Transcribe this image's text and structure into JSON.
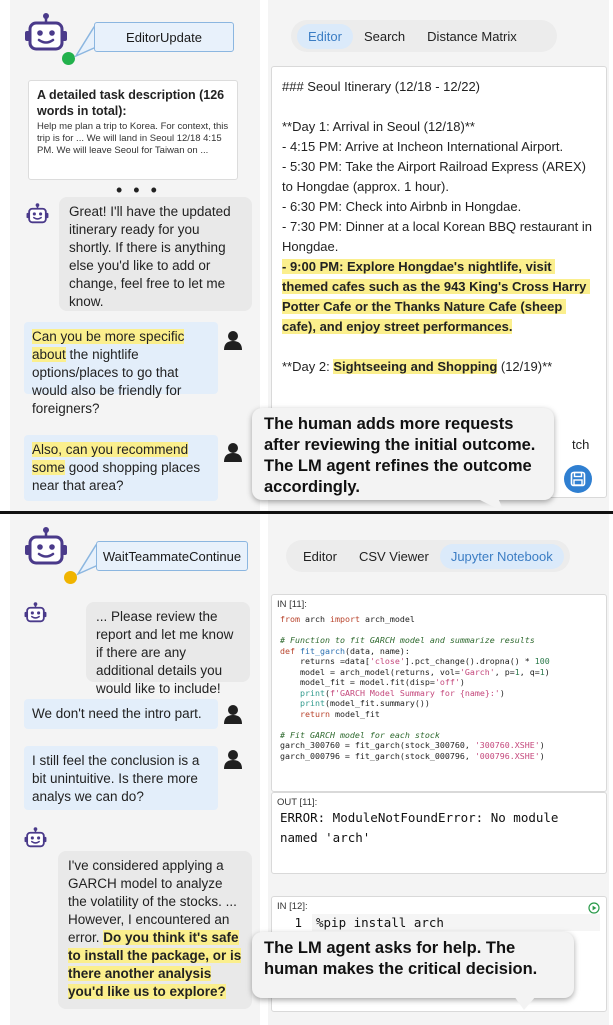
{
  "top": {
    "agent_state": "EditorUpdate",
    "status_color": "#22b14c",
    "task_card": {
      "title": "A detailed task description (126 words in total):",
      "body": "Help me plan a trip to Korea. For context, this trip is for ... We will land in Seoul 12/18 4:15 PM. We will leave Seoul for Taiwan on ..."
    },
    "ellipsis": "• • •",
    "agent_message": "Great! I'll have the updated itinerary ready for you shortly. If there is anything else you'd like to add or change, feel free to let me know.",
    "user_message_1": {
      "highlight": "Can you be more specific about",
      "rest": " the nightlife options/places to go that would also be friendly for foreigners?"
    },
    "user_message_2": {
      "highlight": "Also, can you recommend some",
      "rest": " good shopping places near that area?"
    },
    "tabs": [
      "Editor",
      "Search",
      "Distance Matrix"
    ],
    "active_tab": "Editor",
    "editor": {
      "heading": "### Seoul Itinerary (12/18 - 12/22)",
      "day1": "**Day 1: Arrival in Seoul (12/18)**",
      "lines": [
        "- 4:15 PM: Arrive at Incheon International Airport.",
        "- 5:30 PM: Take the Airport Railroad Express (AREX) to Hongdae (approx. 1 hour).",
        "- 6:30 PM: Check into Airbnb in Hongdae.",
        "- 7:30 PM: Dinner at a local Korean BBQ restaurant in Hongdae."
      ],
      "highlight_line": "- 9:00 PM: Explore Hongdae's nightlife, visit themed cafes such as the 943 King's Cross Harry Potter Cafe or the Thanks Nature Cafe (sheep cafe), and enjoy street performances.",
      "day2_prefix": "**Day 2: ",
      "day2_highlight": "Sightseeing and Shopping",
      "day2_suffix": " (12/19)**",
      "partial_text": "tch"
    },
    "callout": "The human adds more requests after reviewing the initial outcome. The LM agent refines the outcome accordingly."
  },
  "bottom": {
    "agent_state": "WaitTeammateContinue",
    "status_color": "#f0b400",
    "agent_message_1": "... Please review the report and let me know if there are any additional details you would like to include!",
    "user_message_1": "We don't need the intro part.",
    "user_message_2": "I still feel the conclusion is a bit unintuitive. Is there more analys we can do?",
    "agent_message_2": {
      "plain": "I've considered applying a GARCH model to analyze the volatility of the stocks. ... However, I encountered an error. ",
      "highlight": "Do you think it's safe to install the package, or is there another analysis you'd like us to explore?"
    },
    "tabs": [
      "Editor",
      "CSV Viewer",
      "Jupyter Notebook"
    ],
    "active_tab": "Jupyter Notebook",
    "cell1_label": "IN [11]:",
    "out_label": "OUT [11]:",
    "out_text_1": "ERROR: ModuleNotFoundError: No module",
    "out_text_2": "named 'arch'",
    "cell2_label": "IN [12]:",
    "cell2_line_no": "1",
    "cell2_command": "%pip install arch",
    "callout": "The LM agent asks for help. The human makes the critical decision."
  }
}
